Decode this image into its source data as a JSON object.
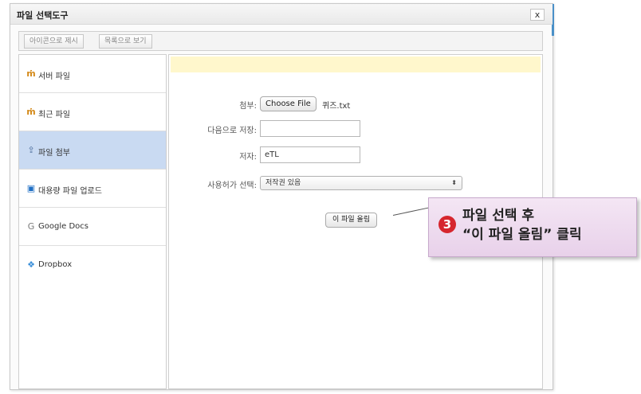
{
  "dialog": {
    "title": "파일 선택도구",
    "close_label": "x"
  },
  "toolbar": {
    "icon_view_label": "아이콘으로 제시",
    "list_view_label": "목록으로 보기"
  },
  "sidebar": {
    "items": [
      {
        "label": "서버 파일",
        "icon": "moodle-icon",
        "glyph": "ṁ"
      },
      {
        "label": "최근 파일",
        "icon": "moodle-icon",
        "glyph": "ṁ"
      },
      {
        "label": "파일 첨부",
        "icon": "upload-icon",
        "glyph": "⇪"
      },
      {
        "label": "대용량 파일 업로드",
        "icon": "large-upload-icon",
        "glyph": "▣"
      },
      {
        "label": "Google Docs",
        "icon": "google-icon",
        "glyph": "G"
      },
      {
        "label": "Dropbox",
        "icon": "dropbox-icon",
        "glyph": "❖"
      }
    ],
    "active_index": 2
  },
  "form": {
    "attach_label": "첨부:",
    "choose_file_label": "Choose File",
    "chosen_file_name": "퀴즈.txt",
    "save_as_label": "다음으로 저장:",
    "save_as_value": "",
    "author_label": "저자:",
    "author_value": "eTL",
    "license_label": "사용허가 선택:",
    "license_value": "저작권 있음",
    "upload_button_label": "이 파일 올림"
  },
  "callout": {
    "step_number": "3",
    "line1": "파일 선택 후",
    "line2": "“이 파일 올림” 클릭"
  },
  "colors": {
    "active_sidebar": "#c9daf2",
    "notice_bar": "#fff7cc",
    "callout_bg": "#ecd8ee",
    "step_badge": "#d6262e"
  }
}
